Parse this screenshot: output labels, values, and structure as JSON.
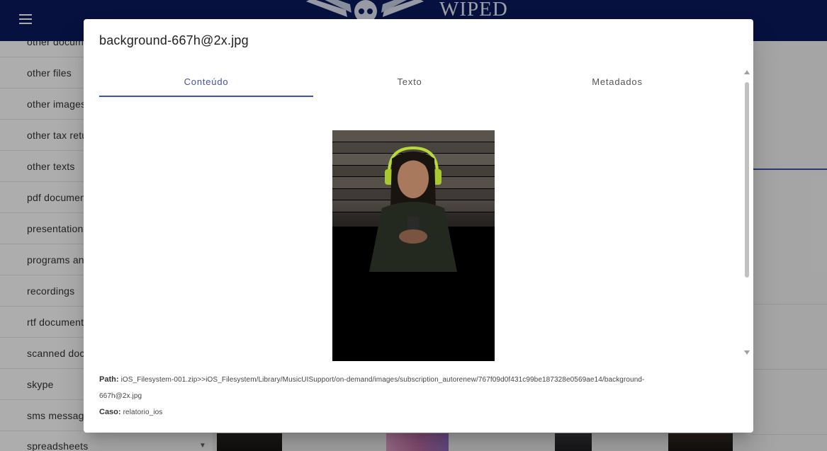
{
  "app": {
    "logo_text": "WIPED",
    "sidebar_items": [
      "other documents",
      "other files",
      "other images",
      "other tax returns",
      "other texts",
      "pdf documents",
      "presentations",
      "programs and libraries",
      "recordings",
      "rtf documents",
      "scanned documents",
      "skype",
      "sms messages",
      "spreadsheets"
    ]
  },
  "dialog": {
    "title": "background-667h@2x.jpg",
    "tabs": [
      {
        "label": "Conteúdo",
        "active": true
      },
      {
        "label": "Texto",
        "active": false
      },
      {
        "label": "Metadados",
        "active": false
      }
    ],
    "path_label": "Path:",
    "path_value_line1": "iOS_Filesystem-001.zip>>iOS_Filesystem/Library/MusicUISupport/on-demand/images/subscription_autorenew/767f09d0f431c99be187328e0569ae14/background-",
    "path_value_line2": "667h@2x.jpg",
    "case_label": "Caso:",
    "case_value": "relatorio_ios"
  },
  "colors": {
    "app_bar": "#0b1a5e",
    "accent": "#3f51b5",
    "backdrop": "rgba(0,0,0,0.32)"
  },
  "icons": [
    "menu-icon",
    "logo-wings-icon",
    "scroll-up-arrow",
    "scroll-down-arrow",
    "dropdown-arrow"
  ]
}
